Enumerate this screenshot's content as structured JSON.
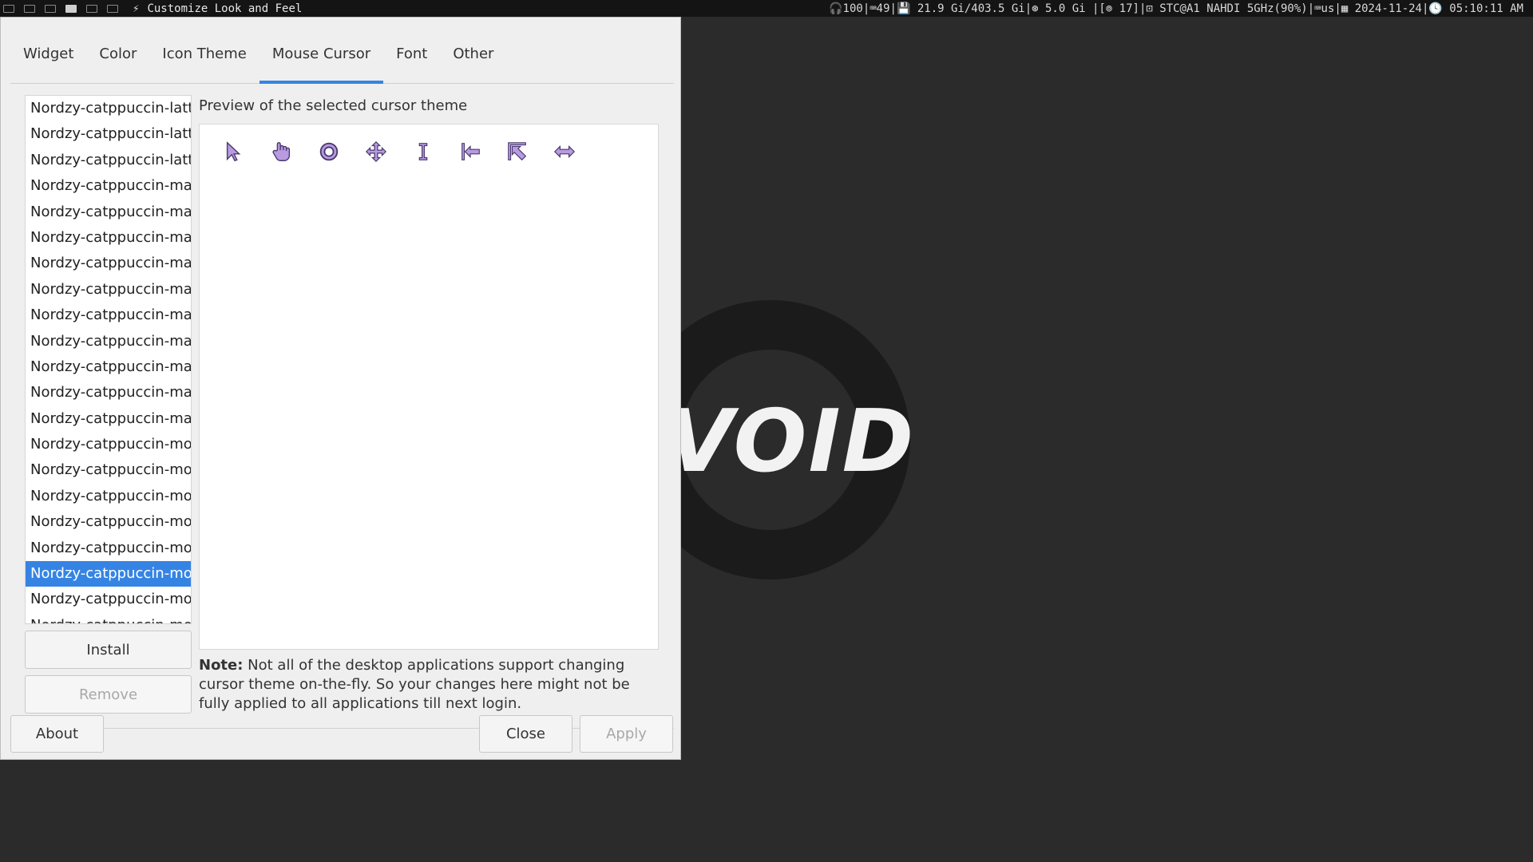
{
  "topbar": {
    "window_title": "Customize Look and Feel",
    "status_text": "🎧100|⌨49|💾 21.9 Gi/403.5 Gi|⊛ 5.0 Gi |[⊚ 17]|⊡ STC@A1 NAHDI 5GHz(90%)|⌨us|▦ 2024-11-24|🕓 05:10:11 AM"
  },
  "wallpaper": {
    "logo_text": "VOID"
  },
  "tabs": [
    "Widget",
    "Color",
    "Icon Theme",
    "Mouse Cursor",
    "Font",
    "Other"
  ],
  "active_tab": "Mouse Cursor",
  "themes": [
    "Nordzy-catppuccin-latte",
    "Nordzy-catppuccin-latte",
    "Nordzy-catppuccin-latte",
    "Nordzy-catppuccin-macchiato",
    "Nordzy-catppuccin-macchiato",
    "Nordzy-catppuccin-macchiato",
    "Nordzy-catppuccin-macchiato",
    "Nordzy-catppuccin-macchiato",
    "Nordzy-catppuccin-macchiato",
    "Nordzy-catppuccin-macchiato",
    "Nordzy-catppuccin-macchiato",
    "Nordzy-catppuccin-macchiato",
    "Nordzy-catppuccin-macchiato",
    "Nordzy-catppuccin-mocha",
    "Nordzy-catppuccin-mocha",
    "Nordzy-catppuccin-mocha",
    "Nordzy-catppuccin-mocha",
    "Nordzy-catppuccin-mocha",
    "Nordzy-catppuccin-mocha",
    "Nordzy-catppuccin-mocha",
    "Nordzy-catppuccin-mocha"
  ],
  "selected_theme_index": 18,
  "buttons": {
    "install": "Install",
    "remove": "Remove",
    "about": "About",
    "close": "Close",
    "apply": "Apply"
  },
  "preview": {
    "label": "Preview of the selected cursor theme",
    "cursors": [
      "arrow-cursor-icon",
      "hand-cursor-icon",
      "wait-cursor-icon",
      "move-cursor-icon",
      "text-cursor-icon",
      "left-side-cursor-icon",
      "top-left-corner-cursor-icon",
      "horizontal-resize-cursor-icon"
    ]
  },
  "note": {
    "bold": "Note:",
    "text": " Not all of the desktop applications support changing cursor theme on-the-fly. So your changes here might not be fully applied to all applications till next login."
  },
  "colors": {
    "accent": "#3584e4",
    "cursor_fill": "#b89be0",
    "cursor_stroke": "#4a3a6e"
  }
}
